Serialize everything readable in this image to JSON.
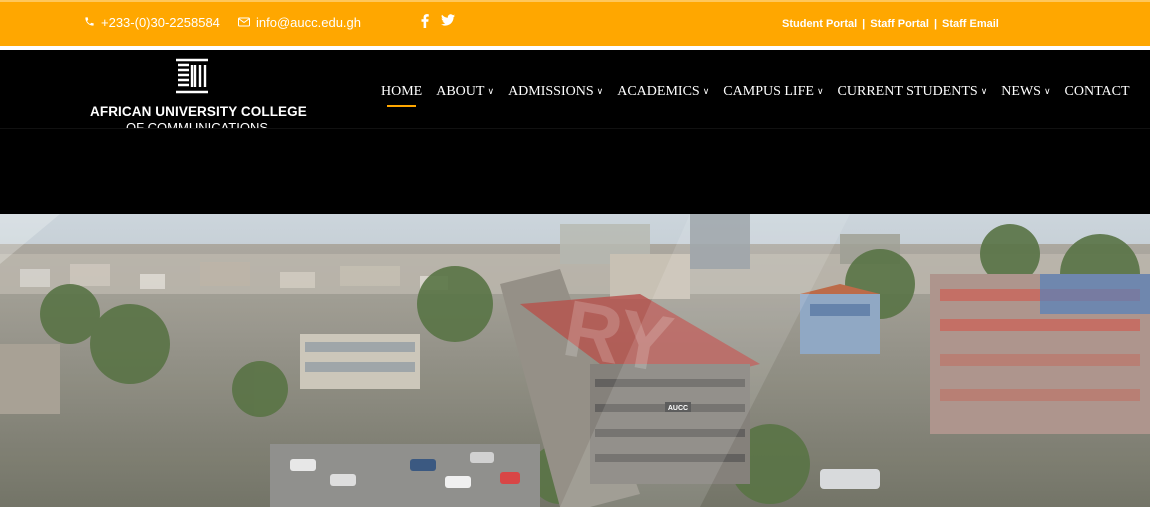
{
  "topbar": {
    "phone": "+233-(0)30-2258584",
    "email": "info@aucc.edu.gh",
    "social": {
      "facebook_icon": "facebook-icon",
      "twitter_icon": "twitter-icon"
    },
    "portals": [
      "Student Portal",
      "Staff Portal",
      "Staff Email"
    ],
    "separator": "|"
  },
  "logo": {
    "line1": "AFRICAN UNIVERSITY COLLEGE",
    "line2": "OF COMMUNICATIONS"
  },
  "nav": {
    "items": [
      {
        "label": "HOME",
        "dropdown": false,
        "active": true
      },
      {
        "label": "ABOUT",
        "dropdown": true
      },
      {
        "label": "ADMISSIONS",
        "dropdown": true
      },
      {
        "label": "ACADEMICS",
        "dropdown": true
      },
      {
        "label": "CAMPUS LIFE",
        "dropdown": true
      },
      {
        "label": "CURRENT STUDENTS",
        "dropdown": true
      },
      {
        "label": "NEWS",
        "dropdown": true
      },
      {
        "label": "CONTACT",
        "dropdown": false
      }
    ]
  },
  "hero": {
    "building_sign": "AUCC"
  },
  "colors": {
    "accent": "#ffa700",
    "header": "#000000"
  }
}
